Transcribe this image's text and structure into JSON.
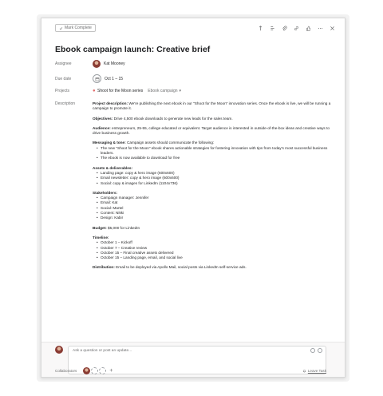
{
  "toolbar": {
    "mark_complete": "Mark Complete",
    "icons": [
      "like-icon",
      "subtasks-icon",
      "attachment-icon",
      "link-icon",
      "thumbs-icon",
      "more-icon",
      "close-icon"
    ]
  },
  "task": {
    "title": "Ebook campaign launch: Creative brief",
    "assignee_label": "Assignee",
    "assignee": "Kat Mooney",
    "due_label": "Due date",
    "due": "Oct 1 – 15",
    "projects_label": "Projects",
    "project_1": "Shoot for the Moon series",
    "project_2": "Ebook campaign",
    "description_label": "Description"
  },
  "description": {
    "p1_b": "Project description:",
    "p1": " We're publishing the next ebook in our \"Shoot for the Moon\" innovation series. Once the ebook is live, we will be running a campaign to promote it.",
    "p2_b": "Objectives:",
    "p2": " Drive 4,500 ebook downloads to generate new leads for the sales team.",
    "p3_b": "Audience:",
    "p3": " entrepreneurs, 25-55, college educated or equivalent. Target audience is interested in outside-of-the-box ideas and creative ways to drive business growth.",
    "p4_b": "Messaging & tone:",
    "p4": " Campaign assets should communicate the following:",
    "msg_1": "The new \"Shoot for the Moon\" ebook shares actionable strategies for fostering innovation with tips from today's most successful business leaders.",
    "msg_2": "The ebook is now available to download for free",
    "assets_h": "Assets & deliverables:",
    "asset_1": "Landing page: copy & hero image (600x600)",
    "asset_2": "Email newsletter: copy & hero image (600x600)",
    "asset_3": "Social: copy & images for LinkedIn (1104x736)",
    "stake_h": "Stakeholders:",
    "stake_1": "Campaign manager: Jennifer",
    "stake_2": "Email: Kat",
    "stake_3": "Social: Martel",
    "stake_4": "Content: Nikki",
    "stake_5": "Design: Kabir",
    "budget_b": "Budget:",
    "budget": " $5,000 for LinkedIn",
    "timeline_h": "Timeline:",
    "time_1": "October 1 – Kickoff",
    "time_2": "October 7 – Creative review",
    "time_3": "October 15 – Final creative assets delivered",
    "time_4": "October 15 – Landing page, email, and social live",
    "dist_b": "Distribution:",
    "dist": " Email to be deployed via Apollo Mail, social posts via LinkedIn self-service ads."
  },
  "comment": {
    "placeholder": "Ask a question or post an update...",
    "collaborators": "Collaborators",
    "leave_task": "Leave Task"
  },
  "colors": {
    "project_dot": "#e36b6b",
    "text": "#1e1f21",
    "muted": "#6d6e6f"
  }
}
